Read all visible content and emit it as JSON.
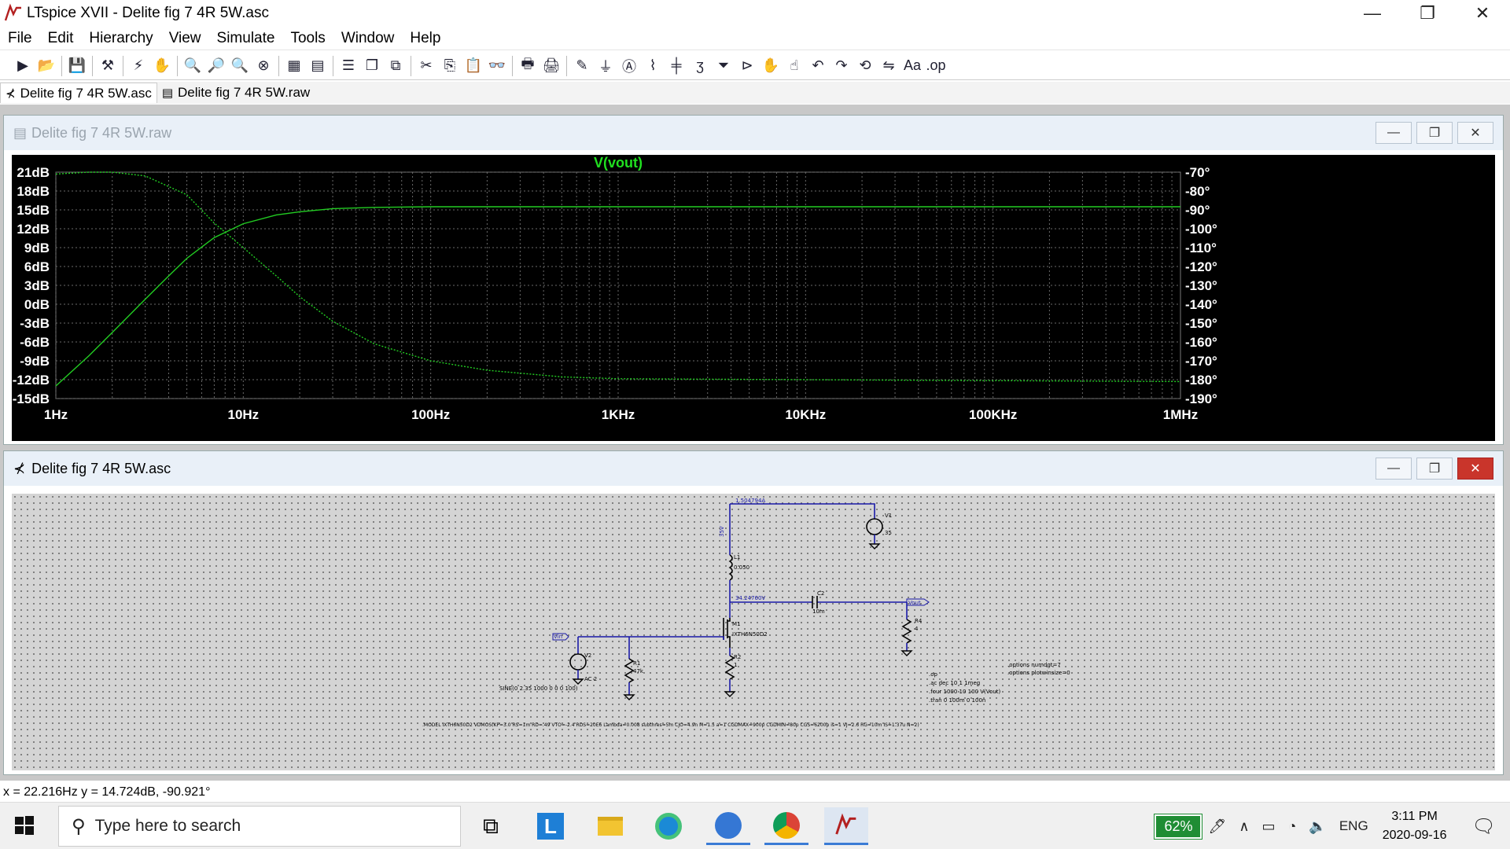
{
  "window": {
    "title": "LTspice XVII - Delite fig 7 4R 5W.asc",
    "minimize": "—",
    "maximize": "❐",
    "close": "✕"
  },
  "menu": [
    "File",
    "Edit",
    "Hierarchy",
    "View",
    "Simulate",
    "Tools",
    "Window",
    "Help"
  ],
  "doc_tabs": [
    {
      "label": "Delite fig 7 4R 5W.asc",
      "icon": "schematic-icon",
      "active": true
    },
    {
      "label": "Delite fig 7 4R 5W.raw",
      "icon": "waveform-icon",
      "active": false
    }
  ],
  "plot_window": {
    "title": "Delite fig 7 4R 5W.raw",
    "trace_label": "V(vout)"
  },
  "chart_data": {
    "type": "line",
    "title": "V(vout)",
    "x_scale": "log",
    "xlim": [
      1,
      1000000
    ],
    "x_ticks": [
      1,
      10,
      100,
      1000,
      10000,
      100000,
      1000000
    ],
    "x_tick_labels": [
      "1Hz",
      "10Hz",
      "100Hz",
      "1KHz",
      "10KHz",
      "100KHz",
      "1MHz"
    ],
    "y_left_label": "",
    "ylim_left": [
      -15,
      21
    ],
    "y_left_ticks": [
      21,
      18,
      15,
      12,
      9,
      6,
      3,
      0,
      -3,
      -6,
      -9,
      -12,
      -15
    ],
    "y_left_tick_labels": [
      "21dB",
      "18dB",
      "15dB",
      "12dB",
      "9dB",
      "6dB",
      "3dB",
      "0dB",
      "-3dB",
      "-6dB",
      "-9dB",
      "-12dB",
      "-15dB"
    ],
    "ylim_right": [
      -190,
      -70
    ],
    "y_right_ticks": [
      -70,
      -80,
      -90,
      -100,
      -110,
      -120,
      -130,
      -140,
      -150,
      -160,
      -170,
      -180,
      -190
    ],
    "y_right_tick_labels": [
      "-70°",
      "-80°",
      "-90°",
      "-100°",
      "-110°",
      "-120°",
      "-130°",
      "-140°",
      "-150°",
      "-160°",
      "-170°",
      "-180°",
      "-190°"
    ],
    "grid": true,
    "series": [
      {
        "name": "V(vout)",
        "axis": "left",
        "style": "solid",
        "x": [
          1,
          1.5,
          2,
          3,
          4,
          5,
          7,
          10,
          15,
          20,
          30,
          50,
          100,
          1000,
          1000000
        ],
        "values": [
          -13,
          -8.2,
          -4.5,
          0.8,
          4.5,
          7.3,
          10.6,
          12.8,
          14.2,
          14.7,
          15.2,
          15.4,
          15.5,
          15.5,
          15.5
        ]
      },
      {
        "name": "V(vout) phase",
        "axis": "right",
        "style": "dotted",
        "x": [
          1,
          1.5,
          2,
          3,
          5,
          7,
          10,
          15,
          20,
          30,
          50,
          100,
          200,
          500,
          1000,
          10000,
          100000,
          1000000
        ],
        "values": [
          -71,
          -70,
          -70,
          -72,
          -82,
          -97,
          -110,
          -125,
          -136,
          -149,
          -161,
          -170,
          -175,
          -178.5,
          -179.5,
          -180,
          -180.5,
          -181
        ]
      }
    ]
  },
  "schematic_window": {
    "title": "Delite fig 7 4R 5W.asc",
    "labels": {
      "supply_current": "1.504794A",
      "rail": "35V",
      "v1": "V1",
      "v1_val": "35",
      "l1": "L1",
      "l1_val": "0.050",
      "drain_v": "34.24760V",
      "c2": "C2",
      "c2_val": "10m",
      "vout": "Vout",
      "r4": "R4",
      "r4_val": "4",
      "m1": "M1",
      "m1_model": "IXTH6N50D2",
      "vin": "Vin",
      "v2": "V2",
      "v2_ac": "AC 2",
      "v2_sine": "SINE(0 2.35 1000 0 0 0 100)",
      "r1": "R1",
      "r1_val": "47k",
      "r2": "R2",
      "r2_val": "1",
      "directives_1": ".op",
      "directives_2": ".ac dec 10 1 1meg",
      "directives_3": ".four 1000 10 100 V(Vout)",
      "directives_4": ".tran 0 100m 0 100n",
      "options_1": ".options numdgt=7",
      "options_2": ".options plotwinsize=0",
      "model": ".MODEL IXTH6N50D2 VDMOS(KP=3.0 RS=1m RD=.49 VTO=-2.4 RDS=20E6 Lambda=0.008 subthres=5m CJO=4.9n M=1.5 a=1 CGDMAX=900p CGDMIN=80p CGS=6200p is=1 VJ=2.6 RG=10m IS=1.37u N=2)"
    }
  },
  "status": {
    "cursor": "x = 22.216Hz    y = 14.724dB, -90.921°"
  },
  "taskbar": {
    "search_placeholder": "Type here to search",
    "battery": "62%",
    "language": "ENG",
    "time": "3:11 PM",
    "date": "2020-09-16"
  }
}
